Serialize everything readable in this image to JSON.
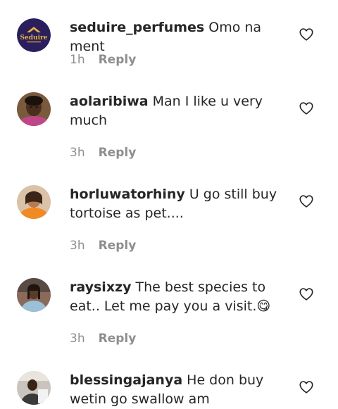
{
  "comments": [
    {
      "username": "seduire_perfumes",
      "text": "Omo na ment",
      "time": "1h",
      "reply_label": "Reply",
      "avatar_logo_text": "Seduire"
    },
    {
      "username": "aolaribiwa",
      "text": "Man I like u very much",
      "time": "3h",
      "reply_label": "Reply"
    },
    {
      "username": "horluwatorhiny",
      "text": "U go still buy tortoise as pet....",
      "time": "3h",
      "reply_label": "Reply"
    },
    {
      "username": "raysixzy",
      "text": "The best species to eat.. Let me pay you a visit.😋",
      "time": "3h",
      "reply_label": "Reply"
    },
    {
      "username": "blessingajanya",
      "text": "He don buy wetin go swallow am",
      "time": "",
      "reply_label": ""
    }
  ],
  "icons": {
    "like": "heart-outline-icon"
  },
  "colors": {
    "text_primary": "#262626",
    "text_secondary": "#8e8e8e",
    "background": "#ffffff"
  }
}
